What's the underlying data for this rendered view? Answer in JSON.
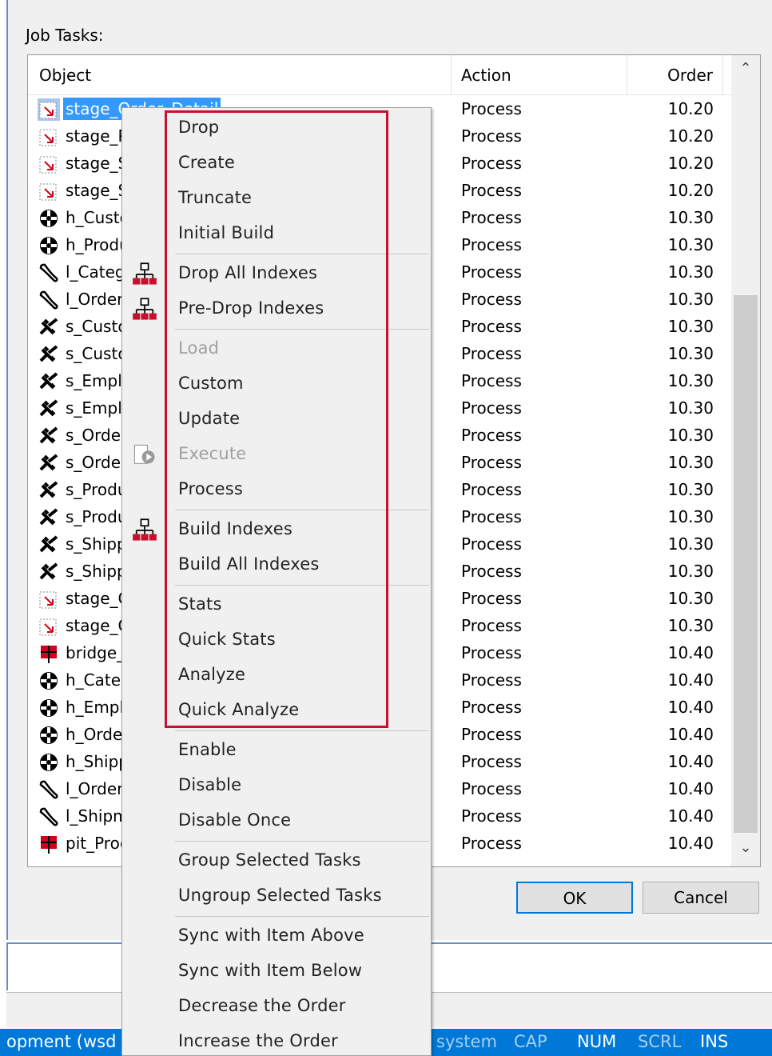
{
  "dialog": {
    "job_tasks_label": "Job Tasks:",
    "ok_label": "OK",
    "cancel_label": "Cancel"
  },
  "list": {
    "headers": {
      "object": "Object",
      "action": "Action",
      "order": "Order"
    },
    "rows": [
      {
        "name": "stage_Order_Detail",
        "icon": "stage-table-icon",
        "action": "Process",
        "order": "10.20",
        "selected": true
      },
      {
        "name": "stage_P",
        "icon": "stage-table-icon",
        "action": "Process",
        "order": "10.20"
      },
      {
        "name": "stage_S",
        "icon": "stage-table-icon",
        "action": "Process",
        "order": "10.20"
      },
      {
        "name": "stage_S",
        "icon": "stage-table-icon",
        "action": "Process",
        "order": "10.20"
      },
      {
        "name": "h_Custo",
        "icon": "hub-icon",
        "action": "Process",
        "order": "10.30"
      },
      {
        "name": "h_Produ",
        "icon": "hub-icon",
        "action": "Process",
        "order": "10.30"
      },
      {
        "name": "l_Categ",
        "icon": "link-icon",
        "action": "Process",
        "order": "10.30"
      },
      {
        "name": "l_Order",
        "icon": "link-icon",
        "action": "Process",
        "order": "10.30"
      },
      {
        "name": "s_Custo",
        "icon": "satellite-icon",
        "action": "Process",
        "order": "10.30"
      },
      {
        "name": "s_Custo",
        "icon": "satellite-icon",
        "action": "Process",
        "order": "10.30"
      },
      {
        "name": "s_Empl",
        "icon": "satellite-icon",
        "action": "Process",
        "order": "10.30"
      },
      {
        "name": "s_Empl",
        "icon": "satellite-icon",
        "action": "Process",
        "order": "10.30"
      },
      {
        "name": "s_Order",
        "icon": "satellite-icon",
        "action": "Process",
        "order": "10.30"
      },
      {
        "name": "s_Order",
        "icon": "satellite-icon",
        "action": "Process",
        "order": "10.30"
      },
      {
        "name": "s_Produ",
        "icon": "satellite-icon",
        "action": "Process",
        "order": "10.30"
      },
      {
        "name": "s_Produ",
        "icon": "satellite-icon",
        "action": "Process",
        "order": "10.30"
      },
      {
        "name": "s_Shipp",
        "icon": "satellite-icon",
        "action": "Process",
        "order": "10.30"
      },
      {
        "name": "s_Shipp",
        "icon": "satellite-icon",
        "action": "Process",
        "order": "10.30"
      },
      {
        "name": "stage_C",
        "icon": "stage-table-icon",
        "action": "Process",
        "order": "10.30"
      },
      {
        "name": "stage_C",
        "icon": "stage-table-icon",
        "action": "Process",
        "order": "10.30"
      },
      {
        "name": "bridge_",
        "icon": "bridge-icon",
        "action": "Process",
        "order": "10.40"
      },
      {
        "name": "h_Categ",
        "icon": "hub-icon",
        "action": "Process",
        "order": "10.40"
      },
      {
        "name": "h_Empl",
        "icon": "hub-icon",
        "action": "Process",
        "order": "10.40"
      },
      {
        "name": "h_Orde",
        "icon": "hub-icon",
        "action": "Process",
        "order": "10.40"
      },
      {
        "name": "h_Shipp",
        "icon": "hub-icon",
        "action": "Process",
        "order": "10.40"
      },
      {
        "name": "l_Order",
        "icon": "link-icon",
        "action": "Process",
        "order": "10.40"
      },
      {
        "name": "l_Shipm",
        "icon": "link-icon",
        "action": "Process",
        "order": "10.40"
      },
      {
        "name": "pit_Prod",
        "icon": "bridge-icon",
        "action": "Process",
        "order": "10.40"
      }
    ]
  },
  "menu": {
    "items": [
      {
        "label": "Drop"
      },
      {
        "label": "Create"
      },
      {
        "label": "Truncate"
      },
      {
        "label": "Initial Build"
      },
      {
        "label": "Drop All Indexes",
        "icon": "index-tree-icon"
      },
      {
        "label": "Pre-Drop Indexes",
        "icon": "index-tree-icon"
      },
      {
        "label": "Load",
        "disabled": true
      },
      {
        "label": "Custom"
      },
      {
        "label": "Update"
      },
      {
        "label": "Execute",
        "disabled": true,
        "icon": "execute-icon"
      },
      {
        "label": "Process"
      },
      {
        "label": "Build Indexes",
        "icon": "index-tree-icon"
      },
      {
        "label": "Build All Indexes"
      },
      {
        "label": "Stats"
      },
      {
        "label": "Quick Stats"
      },
      {
        "label": "Analyze"
      },
      {
        "label": "Quick Analyze"
      },
      {
        "label": "Enable"
      },
      {
        "label": "Disable"
      },
      {
        "label": "Disable Once"
      },
      {
        "label": "Group Selected Tasks"
      },
      {
        "label": "Ungroup Selected Tasks"
      },
      {
        "label": "Sync with Item Above"
      },
      {
        "label": "Sync with Item Below"
      },
      {
        "label": "Decrease the Order"
      },
      {
        "label": "Increase the Order"
      }
    ]
  },
  "statusbar": {
    "left_text": "opment (wsd",
    "system": "system",
    "cap": "CAP",
    "num": "NUM",
    "scrl": "SCRL",
    "ins": "INS"
  },
  "colors": {
    "selection": "#3399ff",
    "highlight_box": "#c8102e",
    "statusbar": "#0078d7"
  }
}
